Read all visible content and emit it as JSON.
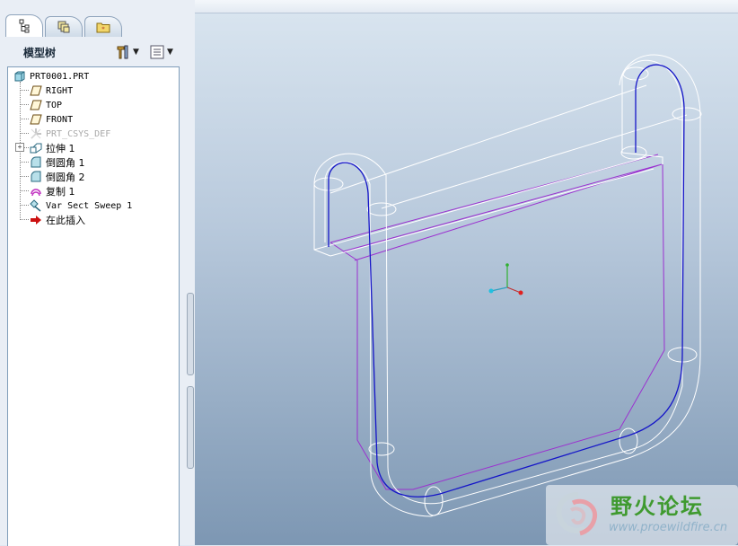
{
  "panel": {
    "tabs": [
      {
        "name": "model-tree-tab-icon",
        "active": true
      },
      {
        "name": "layers-tab-icon",
        "active": false
      },
      {
        "name": "favorites-folder-tab-icon",
        "active": false
      }
    ],
    "title": "模型树"
  },
  "tree": {
    "items": [
      {
        "label": "PRT0001.PRT",
        "icon": "part-icon"
      },
      {
        "label": "RIGHT",
        "icon": "datum-plane-icon"
      },
      {
        "label": "TOP",
        "icon": "datum-plane-icon"
      },
      {
        "label": "FRONT",
        "icon": "datum-plane-icon"
      },
      {
        "label": "PRT_CSYS_DEF",
        "icon": "csys-icon"
      },
      {
        "label": "拉伸 1",
        "icon": "extrude-icon"
      },
      {
        "label": "倒圆角 1",
        "icon": "round-icon"
      },
      {
        "label": "倒圆角 2",
        "icon": "round-icon"
      },
      {
        "label": "复制 1",
        "icon": "copy-icon"
      },
      {
        "label": "Var Sect Sweep 1",
        "icon": "sweep-icon"
      },
      {
        "label": "在此插入",
        "icon": "insert-here-arrow-icon"
      }
    ]
  },
  "watermark": {
    "title": "野火论坛",
    "url": "www.proewildfire.cn"
  },
  "colors": {
    "model_edge": "#ffffff",
    "sweep_path": "#1515c8",
    "sketch_edge": "#9b30d0",
    "insert_arrow": "#cc1010"
  }
}
